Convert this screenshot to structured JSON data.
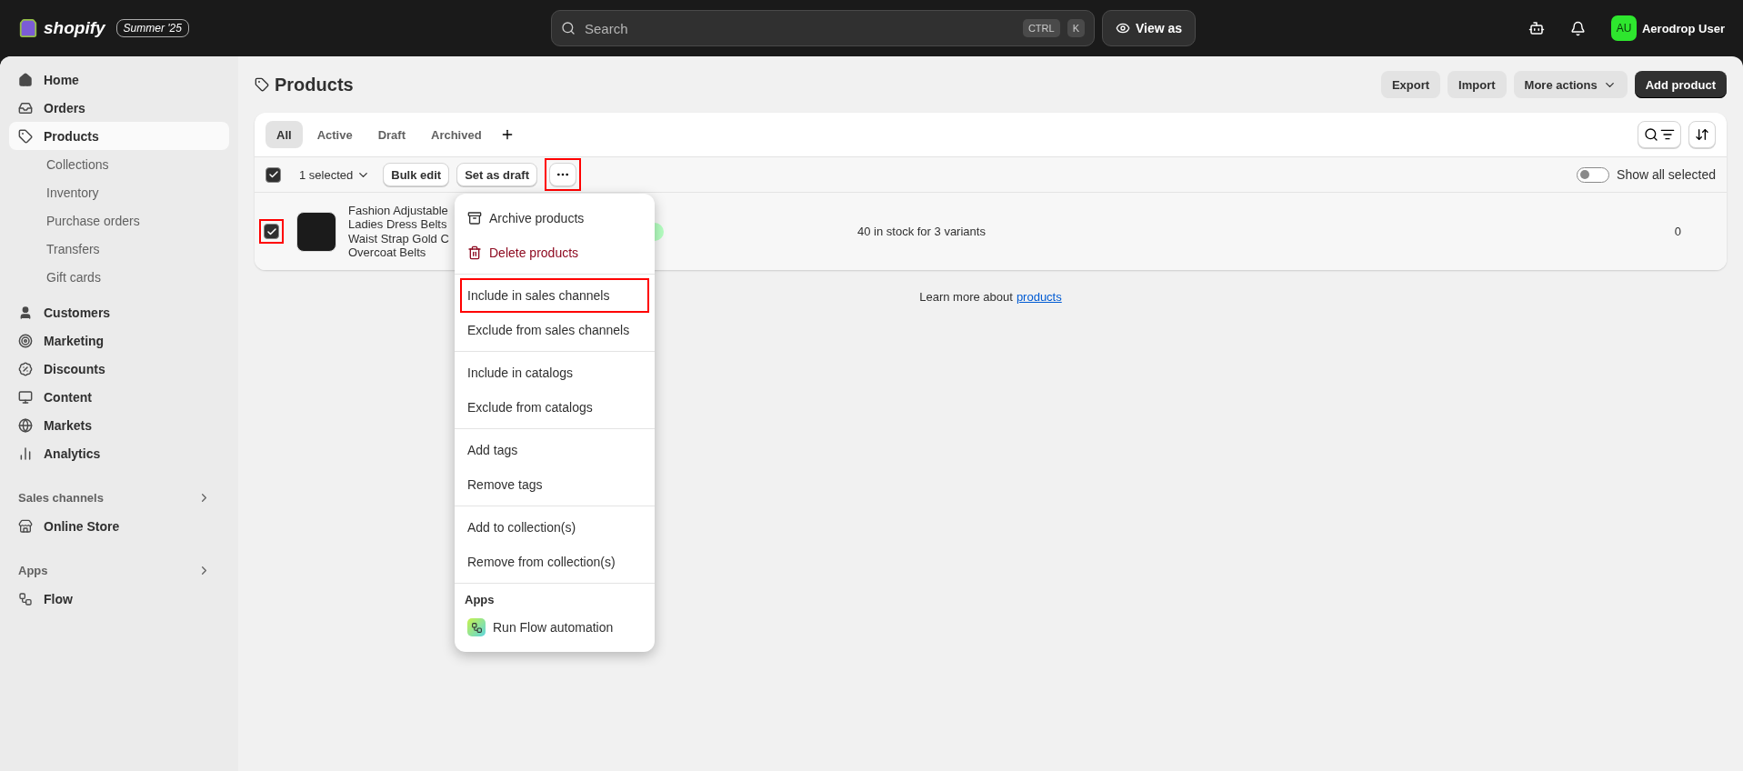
{
  "topbar": {
    "logo": "shopify",
    "edition": "Summer '25",
    "search": {
      "placeholder": "Search"
    },
    "shortcut": [
      "CTRL",
      "K"
    ],
    "view_as": "View as",
    "user": {
      "initials": "AU",
      "name": "Aerodrop User"
    }
  },
  "sidebar": {
    "items": [
      {
        "label": "Home",
        "selected": false
      },
      {
        "label": "Orders",
        "selected": false
      },
      {
        "label": "Products",
        "selected": true,
        "children": [
          {
            "label": "Collections",
            "selected": false
          },
          {
            "label": "Inventory",
            "selected": false
          },
          {
            "label": "Purchase orders",
            "selected": false
          },
          {
            "label": "Transfers",
            "selected": false
          },
          {
            "label": "Gift cards",
            "selected": false
          }
        ]
      },
      {
        "label": "Customers",
        "selected": false
      },
      {
        "label": "Marketing",
        "selected": false
      },
      {
        "label": "Discounts",
        "selected": false
      },
      {
        "label": "Content",
        "selected": false
      },
      {
        "label": "Markets",
        "selected": false
      },
      {
        "label": "Analytics",
        "selected": false
      }
    ],
    "sections": [
      {
        "heading": "Sales channels",
        "items": [
          {
            "label": "Online Store",
            "selected": false
          }
        ]
      },
      {
        "heading": "Apps",
        "items": [
          {
            "label": "Flow",
            "selected": false
          }
        ]
      }
    ]
  },
  "page": {
    "title": "Products",
    "actions": [
      {
        "label": "Export",
        "kind": "secondary"
      },
      {
        "label": "Import",
        "kind": "secondary"
      },
      {
        "label": "More actions",
        "kind": "menu"
      },
      {
        "label": "Add product",
        "kind": "primary"
      }
    ]
  },
  "tabs": [
    {
      "label": "All",
      "selected": true
    },
    {
      "label": "Active",
      "selected": false
    },
    {
      "label": "Draft",
      "selected": false
    },
    {
      "label": "Archived",
      "selected": false
    }
  ],
  "bulk": {
    "checked": true,
    "selected_count": "1 selected",
    "buttons": [
      "Bulk edit",
      "Set as draft"
    ],
    "more_highlighted": true,
    "show_all_selected": {
      "label": "Show all selected",
      "on": false
    }
  },
  "rows": [
    {
      "checked": true,
      "highlighted": true,
      "title_lines": [
        "Fashion Adjustable",
        "Ladies Dress Belts",
        "Waist Strap Gold C",
        "Overcoat Belts"
      ],
      "inventory": "40 in stock for 3 variants",
      "column_5": "0"
    }
  ],
  "footer": {
    "text": "Learn more about",
    "link": "products"
  },
  "menu": {
    "sections": [
      {
        "items": [
          {
            "label": "Archive products",
            "kind": "archive",
            "highlighted": false
          },
          {
            "label": "Delete products",
            "kind": "destructive",
            "highlighted": false
          }
        ]
      },
      {
        "items": [
          {
            "label": "Include in sales channels",
            "kind": "plain",
            "highlighted": true
          },
          {
            "label": "Exclude from sales channels",
            "kind": "plain",
            "highlighted": false
          }
        ]
      },
      {
        "items": [
          {
            "label": "Include in catalogs",
            "kind": "plain",
            "highlighted": false
          },
          {
            "label": "Exclude from catalogs",
            "kind": "plain",
            "highlighted": false
          }
        ]
      },
      {
        "items": [
          {
            "label": "Add tags",
            "kind": "plain",
            "highlighted": false
          },
          {
            "label": "Remove tags",
            "kind": "plain",
            "highlighted": false
          }
        ]
      },
      {
        "items": [
          {
            "label": "Add to collection(s)",
            "kind": "plain",
            "highlighted": false
          },
          {
            "label": "Remove from collection(s)",
            "kind": "plain",
            "highlighted": false
          }
        ]
      },
      {
        "heading": "Apps",
        "items": [
          {
            "label": "Run Flow automation",
            "kind": "app",
            "highlighted": false
          }
        ]
      }
    ]
  }
}
